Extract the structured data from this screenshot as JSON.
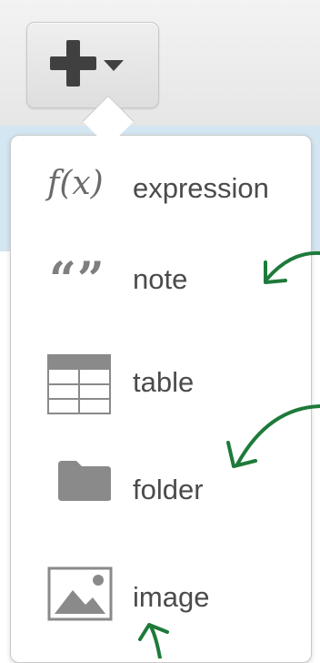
{
  "toolbar": {
    "add_button": {
      "icon": "plus-icon",
      "caret_icon": "caret-down-icon"
    }
  },
  "menu": {
    "items": [
      {
        "label": "expression",
        "icon": "function-icon",
        "icon_text": "f(x)"
      },
      {
        "label": "note",
        "icon": "quote-icon",
        "icon_text": "“”"
      },
      {
        "label": "table",
        "icon": "table-icon"
      },
      {
        "label": "folder",
        "icon": "folder-icon"
      },
      {
        "label": "image",
        "icon": "image-icon"
      }
    ]
  },
  "annotations": {
    "arrow_color": "#1e7a3a"
  },
  "colors": {
    "icon_gray": "#8a8a8a",
    "label_gray": "#4b4b4b",
    "strip_blue": "#d3e6f1"
  }
}
